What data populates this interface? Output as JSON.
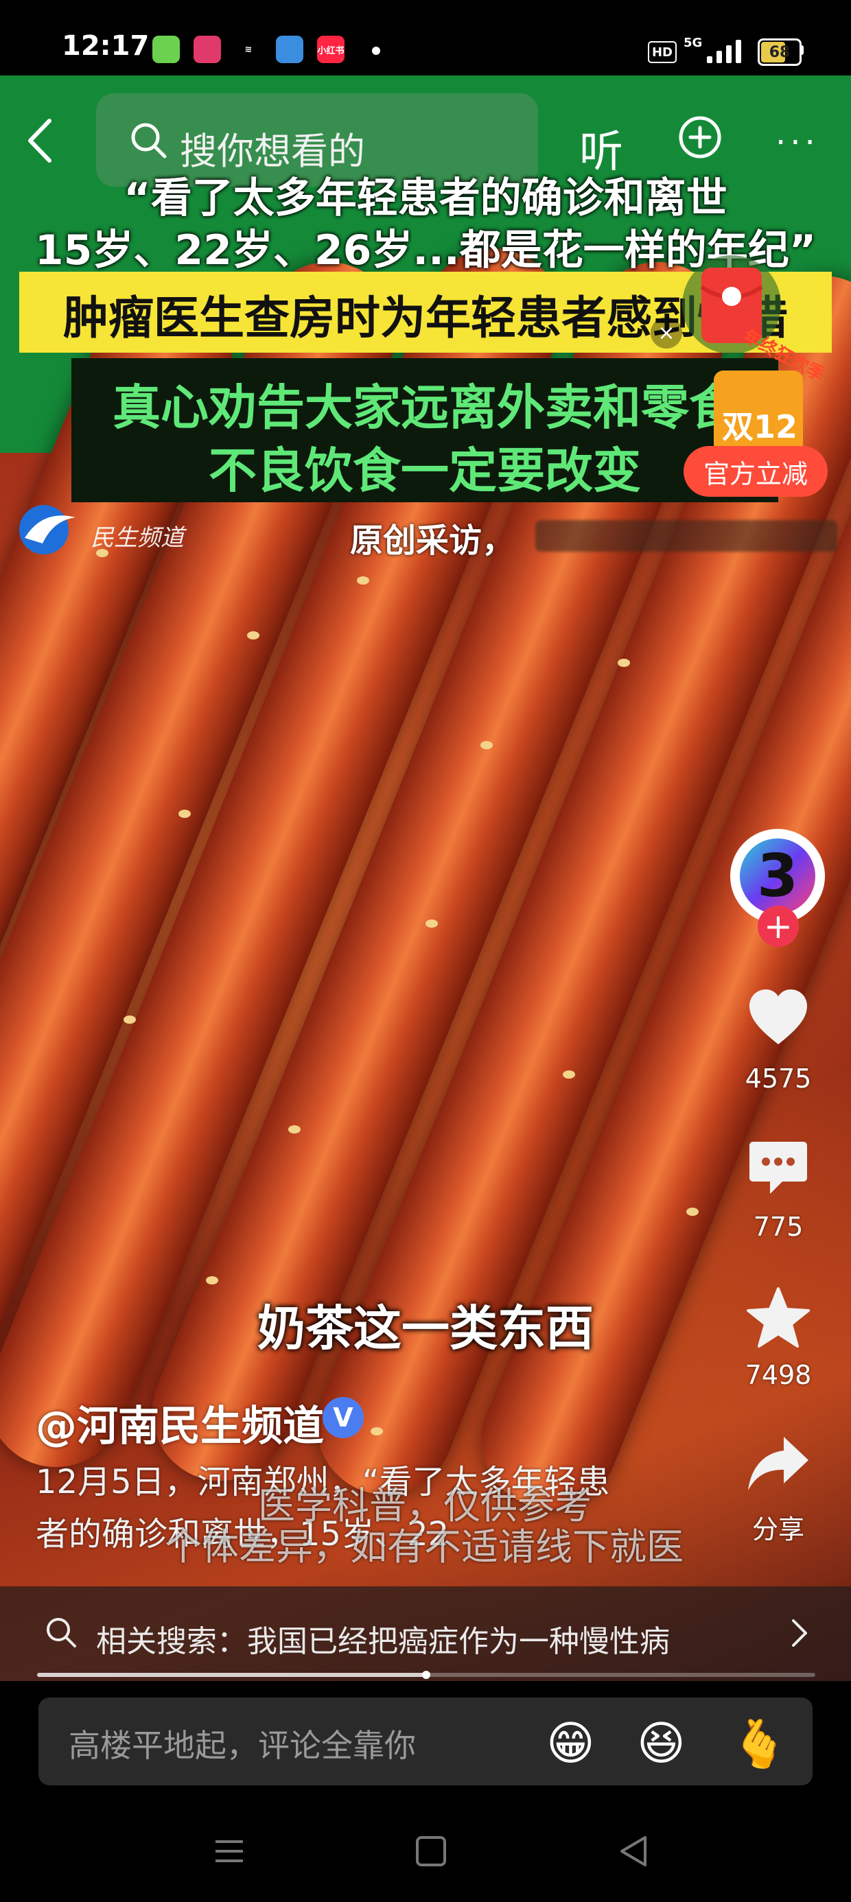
{
  "status_bar": {
    "time": "12:17",
    "apps": [
      {
        "name": "app-green-icon",
        "label": "",
        "color": "#6ad24e"
      },
      {
        "name": "app-pinduoduo-icon",
        "label": "",
        "color": "#e03a6a"
      },
      {
        "name": "app-z-icon",
        "label": "≋",
        "color": "#000000"
      },
      {
        "name": "app-cloud-icon",
        "label": "",
        "color": "#3b8de0"
      },
      {
        "name": "app-xiaohongshu-icon",
        "label": "小红书",
        "color": "#ff2442"
      }
    ],
    "hd": "HD",
    "network": "5G",
    "battery": "68",
    "battery_level_percent": 68
  },
  "top_nav": {
    "search_placeholder": "搜你想看的",
    "listen_label": "听",
    "more_label": "···"
  },
  "video": {
    "caption_line1": "“看了太多年轻患者的确诊和离世",
    "caption_line2": "15岁、22岁、26岁...都是花一样的年纪”",
    "caption_yellow": "肿瘤医生查房时为年轻患者感到惋惜",
    "caption_green1": "真心劝告大家远离外卖和零食",
    "caption_green2": "不良饮食一定要改变",
    "channel_name": "民生频道",
    "interview_label": "原创采访，",
    "subtitle": "奶茶这一类东西",
    "watermark_line1": "医学科普，仅供参考",
    "watermark_line2": "个体差异，如有不适请线下就医"
  },
  "promo": {
    "tag": "年终狂欢季",
    "double12": "双12",
    "button": "官方立减",
    "close": "×"
  },
  "actions": {
    "avatar_label": "3",
    "follow_label": "+",
    "likes": "4575",
    "comments": "775",
    "favorites": "7498",
    "share": "分享"
  },
  "post": {
    "author": "@河南民生频道",
    "verified_mark": "V",
    "description_line1": "12月5日，河南郑州，“看了太多年轻患",
    "description_line2": "者的确诊和离世，15岁、22"
  },
  "related_search": {
    "text": "相关搜索：我国已经把癌症作为一种慢性病"
  },
  "progress": {
    "played_fraction": 0.5
  },
  "comment_bar": {
    "placeholder": "高楼平地起，评论全靠你",
    "emojis": [
      "😁",
      "😆",
      "🫰"
    ]
  },
  "colors": {
    "banner_green": "#148a38",
    "caption_yellow_bg": "#f6e437",
    "caption_green_text": "#5fe878",
    "follow_red": "#f0364f",
    "promo_red": "#ff4b3a"
  }
}
